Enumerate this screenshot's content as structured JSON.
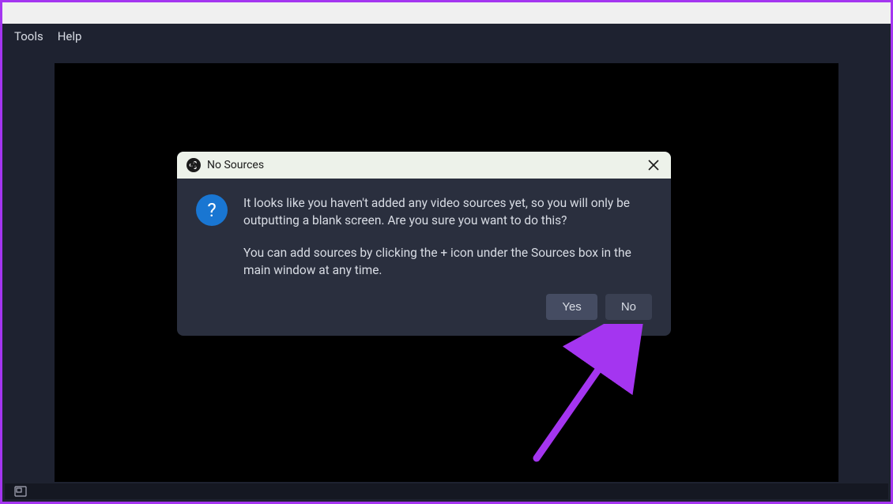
{
  "menu": {
    "tools": "Tools",
    "help": "Help"
  },
  "dialog": {
    "title": "No Sources",
    "question_mark": "?",
    "paragraph1": "It looks like you haven't added any video sources yet, so you will only be outputting a blank screen. Are you sure you want to do this?",
    "paragraph2": "You can add sources by clicking the + icon under the Sources box in the main window at any time.",
    "yes_button": "Yes",
    "no_button": "No"
  },
  "colors": {
    "accent_purple": "#a435f0",
    "dialog_bg": "#2a2f3e",
    "header_bg": "#edf2ea"
  }
}
